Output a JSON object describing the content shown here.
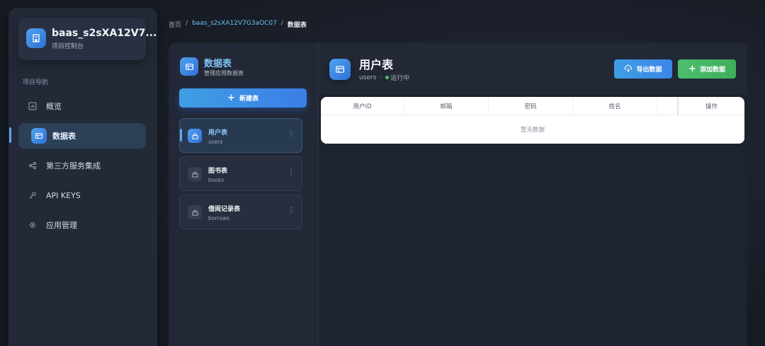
{
  "project": {
    "name": "baas_s2sXA12V7...",
    "subtitle": "项目控制台"
  },
  "nav": {
    "title": "项目导航",
    "items": [
      {
        "label": "概览",
        "icon": "chart-icon"
      },
      {
        "label": "数据表",
        "icon": "table-icon",
        "active": true
      },
      {
        "label": "第三方服务集成",
        "icon": "share-icon"
      },
      {
        "label": "API KEYS",
        "icon": "key-icon"
      },
      {
        "label": "应用管理",
        "icon": "gear-icon"
      }
    ]
  },
  "breadcrumb": {
    "home": "首页",
    "sep": "/",
    "project": "baas_s2sXA12V7G3aOC07",
    "current": "数据表"
  },
  "tables_panel": {
    "title": "数据表",
    "subtitle": "管理应用数据表",
    "new_button": "新建表",
    "tables": [
      {
        "name": "用户表",
        "key": "users",
        "active": true
      },
      {
        "name": "图书表",
        "key": "books"
      },
      {
        "name": "借阅记录表",
        "key": "borrows"
      }
    ]
  },
  "main": {
    "title": "用户表",
    "key": "users",
    "separator": "·",
    "status": "运行中",
    "export_button": "导出数据",
    "add_button": "添加数据",
    "columns": [
      "用户ID",
      "邮箱",
      "密码",
      "姓名",
      "",
      "操作"
    ],
    "empty_text": "暂无数据"
  },
  "colors": {
    "accent_blue": "#3f9ee4",
    "accent_green": "#4cbf6c",
    "status_green": "#4cc26b"
  }
}
